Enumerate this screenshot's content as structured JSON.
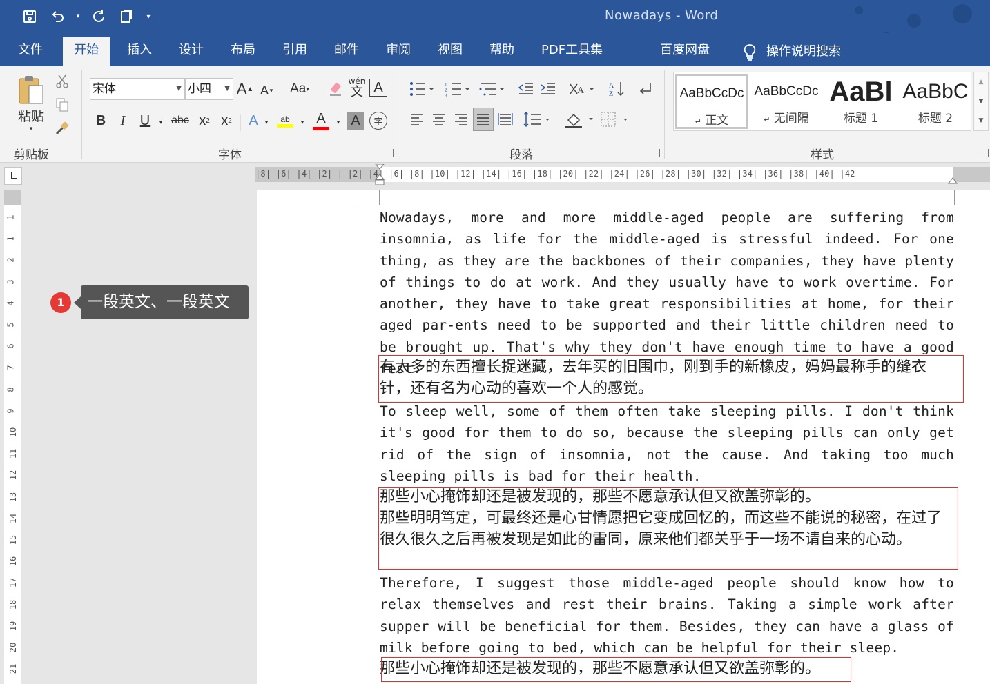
{
  "window": {
    "title": "Nowadays  -  Word"
  },
  "ribbon_tabs": [
    {
      "label": "文件",
      "active": false
    },
    {
      "label": "开始",
      "active": true
    },
    {
      "label": "插入",
      "active": false
    },
    {
      "label": "设计",
      "active": false
    },
    {
      "label": "布局",
      "active": false
    },
    {
      "label": "引用",
      "active": false
    },
    {
      "label": "邮件",
      "active": false
    },
    {
      "label": "审阅",
      "active": false
    },
    {
      "label": "视图",
      "active": false
    },
    {
      "label": "帮助",
      "active": false
    },
    {
      "label": "PDF工具集",
      "active": false
    },
    {
      "label": "百度网盘",
      "active": false
    },
    {
      "label": "操作说明搜索",
      "active": false
    }
  ],
  "clipboard": {
    "paste_label": "粘贴",
    "group_label": "剪贴板"
  },
  "font": {
    "font_name": "宋体",
    "font_size": "小四",
    "group_label": "字体",
    "grow_label": "A",
    "shrink_label": "A",
    "case_label": "Aa",
    "bold": "B",
    "italic": "I",
    "underline": "U",
    "strike": "abc",
    "subscript": "x",
    "superscript": "x",
    "phonetic": "wén",
    "highlight_color": "#ffff00",
    "font_color": "#ff0000"
  },
  "paragraph": {
    "group_label": "段落"
  },
  "styles": {
    "group_label": "样式",
    "items": [
      {
        "sample": "AaBbCcDc",
        "name": "正文"
      },
      {
        "sample": "AaBbCcDc",
        "name": "无间隔"
      },
      {
        "sample": "AaBl",
        "name": "标题 1"
      },
      {
        "sample": "AaBbC",
        "name": "标题 2"
      }
    ]
  },
  "ruler": {
    "horizontal_labels": "|8|  |6|  |4|  |2|  |   |2|  |4|  |6|  |8| |10| |12| |14| |16| |18| |20| |22| |24| |26| |28| |30| |32| |34| |36| |38| |40| |42",
    "vertical_labels": [
      "1",
      "1",
      "2",
      "3",
      "4",
      "5",
      "6",
      "7",
      "8",
      "9",
      "10",
      "11",
      "12",
      "13",
      "14",
      "15",
      "16",
      "17",
      "18",
      "19",
      "20",
      "21"
    ]
  },
  "callout": {
    "number": "1",
    "text": "一段英文、一段英文"
  },
  "document": {
    "en_1": "Nowadays, more and more middle-aged people are suffering from insomnia, as life for the middle-aged is stressful indeed. For one thing, as they are the backbones of their companies, they have plenty of things to do at work. And they usually have to work overtime. For another, they have to take great responsibilities at home, for their aged par-ents need to be supported and their little children need to be brought up. That's why they don't have enough time to have a good rest.",
    "zh_1": "有太多的东西擅长捉迷藏，去年买的旧围巾，刚到手的新橡皮，妈妈最称手的缝衣针，还有名为心动的喜欢一个人的感觉。",
    "en_2": "To sleep well, some of them often take sleeping pills. I don't think it's good for them to do so, because the sleeping pills can only get rid of the sign of insomnia, not the cause. And taking too much sleeping pills is bad for their health.",
    "zh_2a": "那些小心掩饰却还是被发现的，那些不愿意承认但又欲盖弥彰的。",
    "zh_2b": "那些明明笃定，可最终还是心甘情愿把它变成回忆的，而这些不能说的秘密，在过了很久很久之后再被发现是如此的雷同，原来他们都关乎于一场不请自来的心动。",
    "en_3": "Therefore, I suggest those middle-aged people should know how to relax themselves and rest their brains. Taking a simple work after supper will be beneficial for them. Besides, they can have a glass of milk before going to bed, which can be helpful for their sleep.",
    "zh_3": "那些小心掩饰却还是被发现的，那些不愿意承认但又欲盖弥彰的。"
  }
}
